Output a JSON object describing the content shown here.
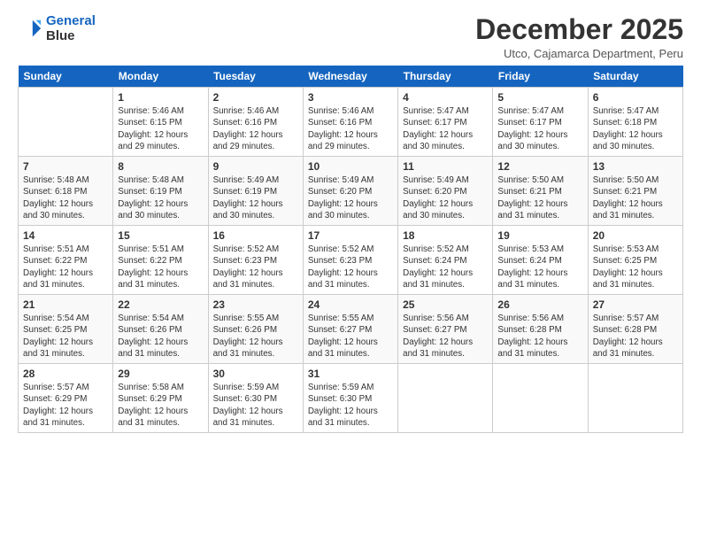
{
  "logo": {
    "line1": "General",
    "line2": "Blue"
  },
  "title": "December 2025",
  "subtitle": "Utco, Cajamarca Department, Peru",
  "headers": [
    "Sunday",
    "Monday",
    "Tuesday",
    "Wednesday",
    "Thursday",
    "Friday",
    "Saturday"
  ],
  "weeks": [
    [
      {
        "day": "",
        "info": ""
      },
      {
        "day": "1",
        "info": "Sunrise: 5:46 AM\nSunset: 6:15 PM\nDaylight: 12 hours\nand 29 minutes."
      },
      {
        "day": "2",
        "info": "Sunrise: 5:46 AM\nSunset: 6:16 PM\nDaylight: 12 hours\nand 29 minutes."
      },
      {
        "day": "3",
        "info": "Sunrise: 5:46 AM\nSunset: 6:16 PM\nDaylight: 12 hours\nand 29 minutes."
      },
      {
        "day": "4",
        "info": "Sunrise: 5:47 AM\nSunset: 6:17 PM\nDaylight: 12 hours\nand 30 minutes."
      },
      {
        "day": "5",
        "info": "Sunrise: 5:47 AM\nSunset: 6:17 PM\nDaylight: 12 hours\nand 30 minutes."
      },
      {
        "day": "6",
        "info": "Sunrise: 5:47 AM\nSunset: 6:18 PM\nDaylight: 12 hours\nand 30 minutes."
      }
    ],
    [
      {
        "day": "7",
        "info": "Sunrise: 5:48 AM\nSunset: 6:18 PM\nDaylight: 12 hours\nand 30 minutes."
      },
      {
        "day": "8",
        "info": "Sunrise: 5:48 AM\nSunset: 6:19 PM\nDaylight: 12 hours\nand 30 minutes."
      },
      {
        "day": "9",
        "info": "Sunrise: 5:49 AM\nSunset: 6:19 PM\nDaylight: 12 hours\nand 30 minutes."
      },
      {
        "day": "10",
        "info": "Sunrise: 5:49 AM\nSunset: 6:20 PM\nDaylight: 12 hours\nand 30 minutes."
      },
      {
        "day": "11",
        "info": "Sunrise: 5:49 AM\nSunset: 6:20 PM\nDaylight: 12 hours\nand 30 minutes."
      },
      {
        "day": "12",
        "info": "Sunrise: 5:50 AM\nSunset: 6:21 PM\nDaylight: 12 hours\nand 31 minutes."
      },
      {
        "day": "13",
        "info": "Sunrise: 5:50 AM\nSunset: 6:21 PM\nDaylight: 12 hours\nand 31 minutes."
      }
    ],
    [
      {
        "day": "14",
        "info": "Sunrise: 5:51 AM\nSunset: 6:22 PM\nDaylight: 12 hours\nand 31 minutes."
      },
      {
        "day": "15",
        "info": "Sunrise: 5:51 AM\nSunset: 6:22 PM\nDaylight: 12 hours\nand 31 minutes."
      },
      {
        "day": "16",
        "info": "Sunrise: 5:52 AM\nSunset: 6:23 PM\nDaylight: 12 hours\nand 31 minutes."
      },
      {
        "day": "17",
        "info": "Sunrise: 5:52 AM\nSunset: 6:23 PM\nDaylight: 12 hours\nand 31 minutes."
      },
      {
        "day": "18",
        "info": "Sunrise: 5:52 AM\nSunset: 6:24 PM\nDaylight: 12 hours\nand 31 minutes."
      },
      {
        "day": "19",
        "info": "Sunrise: 5:53 AM\nSunset: 6:24 PM\nDaylight: 12 hours\nand 31 minutes."
      },
      {
        "day": "20",
        "info": "Sunrise: 5:53 AM\nSunset: 6:25 PM\nDaylight: 12 hours\nand 31 minutes."
      }
    ],
    [
      {
        "day": "21",
        "info": "Sunrise: 5:54 AM\nSunset: 6:25 PM\nDaylight: 12 hours\nand 31 minutes."
      },
      {
        "day": "22",
        "info": "Sunrise: 5:54 AM\nSunset: 6:26 PM\nDaylight: 12 hours\nand 31 minutes."
      },
      {
        "day": "23",
        "info": "Sunrise: 5:55 AM\nSunset: 6:26 PM\nDaylight: 12 hours\nand 31 minutes."
      },
      {
        "day": "24",
        "info": "Sunrise: 5:55 AM\nSunset: 6:27 PM\nDaylight: 12 hours\nand 31 minutes."
      },
      {
        "day": "25",
        "info": "Sunrise: 5:56 AM\nSunset: 6:27 PM\nDaylight: 12 hours\nand 31 minutes."
      },
      {
        "day": "26",
        "info": "Sunrise: 5:56 AM\nSunset: 6:28 PM\nDaylight: 12 hours\nand 31 minutes."
      },
      {
        "day": "27",
        "info": "Sunrise: 5:57 AM\nSunset: 6:28 PM\nDaylight: 12 hours\nand 31 minutes."
      }
    ],
    [
      {
        "day": "28",
        "info": "Sunrise: 5:57 AM\nSunset: 6:29 PM\nDaylight: 12 hours\nand 31 minutes."
      },
      {
        "day": "29",
        "info": "Sunrise: 5:58 AM\nSunset: 6:29 PM\nDaylight: 12 hours\nand 31 minutes."
      },
      {
        "day": "30",
        "info": "Sunrise: 5:59 AM\nSunset: 6:30 PM\nDaylight: 12 hours\nand 31 minutes."
      },
      {
        "day": "31",
        "info": "Sunrise: 5:59 AM\nSunset: 6:30 PM\nDaylight: 12 hours\nand 31 minutes."
      },
      {
        "day": "",
        "info": ""
      },
      {
        "day": "",
        "info": ""
      },
      {
        "day": "",
        "info": ""
      }
    ]
  ]
}
